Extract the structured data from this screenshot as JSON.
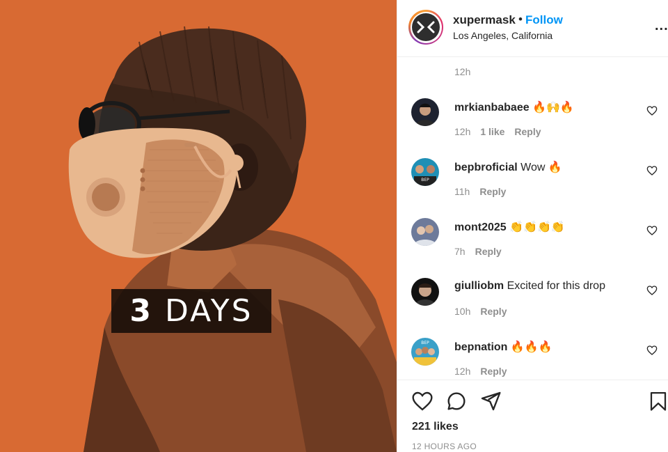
{
  "post": {
    "image_caption": "3 DAYS",
    "image_caption_number": "3",
    "image_caption_word": "DAYS",
    "accent_color": "#d86a33"
  },
  "header": {
    "username": "xupermask",
    "separator": "•",
    "follow_label": "Follow",
    "location": "Los Angeles, California",
    "more_icon": "more-horizontal-icon",
    "more_label": "..."
  },
  "comments": {
    "top_timestamp": "12h",
    "items": [
      {
        "username": "mrkianbabaee",
        "text": "🔥🙌🔥",
        "time": "12h",
        "likes": "1 like",
        "reply": "Reply",
        "avatar_color": "#1d2230"
      },
      {
        "username": "bepbroficial",
        "text": "Wow 🔥",
        "time": "11h",
        "likes": "",
        "reply": "Reply",
        "avatar_color": "#1f8fb5"
      },
      {
        "username": "mont2025",
        "text": "👏👏👏👏",
        "time": "7h",
        "likes": "",
        "reply": "Reply",
        "avatar_color": "#6d7a9a"
      },
      {
        "username": "giulliobm",
        "text": "Excited for this drop",
        "time": "10h",
        "likes": "",
        "reply": "Reply",
        "avatar_color": "#111111"
      },
      {
        "username": "bepnation",
        "text": "🔥🔥🔥",
        "time": "12h",
        "likes": "",
        "reply": "Reply",
        "avatar_color": "#3aa0c8"
      }
    ]
  },
  "actions": {
    "like_icon": "heart-icon",
    "comment_icon": "comment-icon",
    "share_icon": "send-icon",
    "save_icon": "bookmark-icon"
  },
  "stats": {
    "likes": "221 likes",
    "posted_ago": "12 HOURS AGO"
  },
  "colors": {
    "link_blue": "#0095f6",
    "muted": "#8e8e8e",
    "text": "#262626"
  }
}
